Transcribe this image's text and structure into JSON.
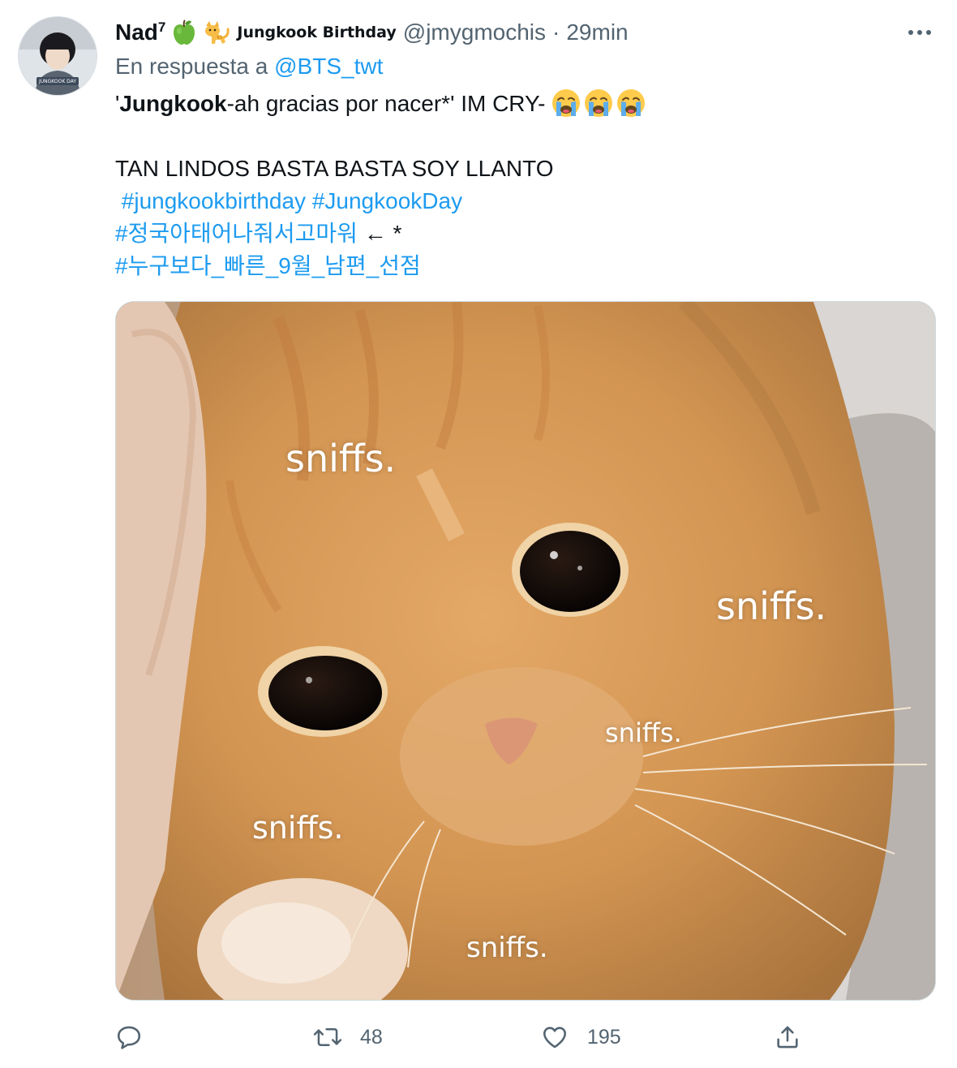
{
  "tweet": {
    "display_name": "Nad",
    "name_superscript": "7",
    "name_emojis": [
      "green-apple",
      "cat"
    ],
    "name_caption": "Jungkook Birthday",
    "handle": "@jmygmochis",
    "separator": "·",
    "time": "29min",
    "reply_prefix": "En respuesta a ",
    "reply_to": "@BTS_twt",
    "line1_bold": "Jungkook",
    "line1_prefix": "'",
    "line1_rest": "-ah gracias por nacer*'  IM CRY- ",
    "line1_emojis": [
      "loudly-crying-face",
      "loudly-crying-face",
      "loudly-crying-face"
    ],
    "line2": "TAN LINDOS BASTA BASTA SOY LLANTO",
    "hashtag1": "#jungkookbirthday",
    "hashtag2": "#JungkookDay",
    "hashtag3": "#정국아태어나줘서고마워",
    "hashtag3_suffix": " ← *",
    "hashtag4": "#누구보다_빠른_9월_남편_선점"
  },
  "media": {
    "description_icon": "crying-cat-meme",
    "captions": [
      "sniffs.",
      "sniffs.",
      "sniffs.",
      "sniffs.",
      "sniffs."
    ]
  },
  "avatar": {
    "badge_text": "JUNGKOOK DAY"
  },
  "actions": {
    "reply_count": "",
    "retweet_count": "48",
    "like_count": "195",
    "share_count": ""
  },
  "colors": {
    "link": "#1d9bf0",
    "secondary": "#536471",
    "text": "#0f1419"
  }
}
